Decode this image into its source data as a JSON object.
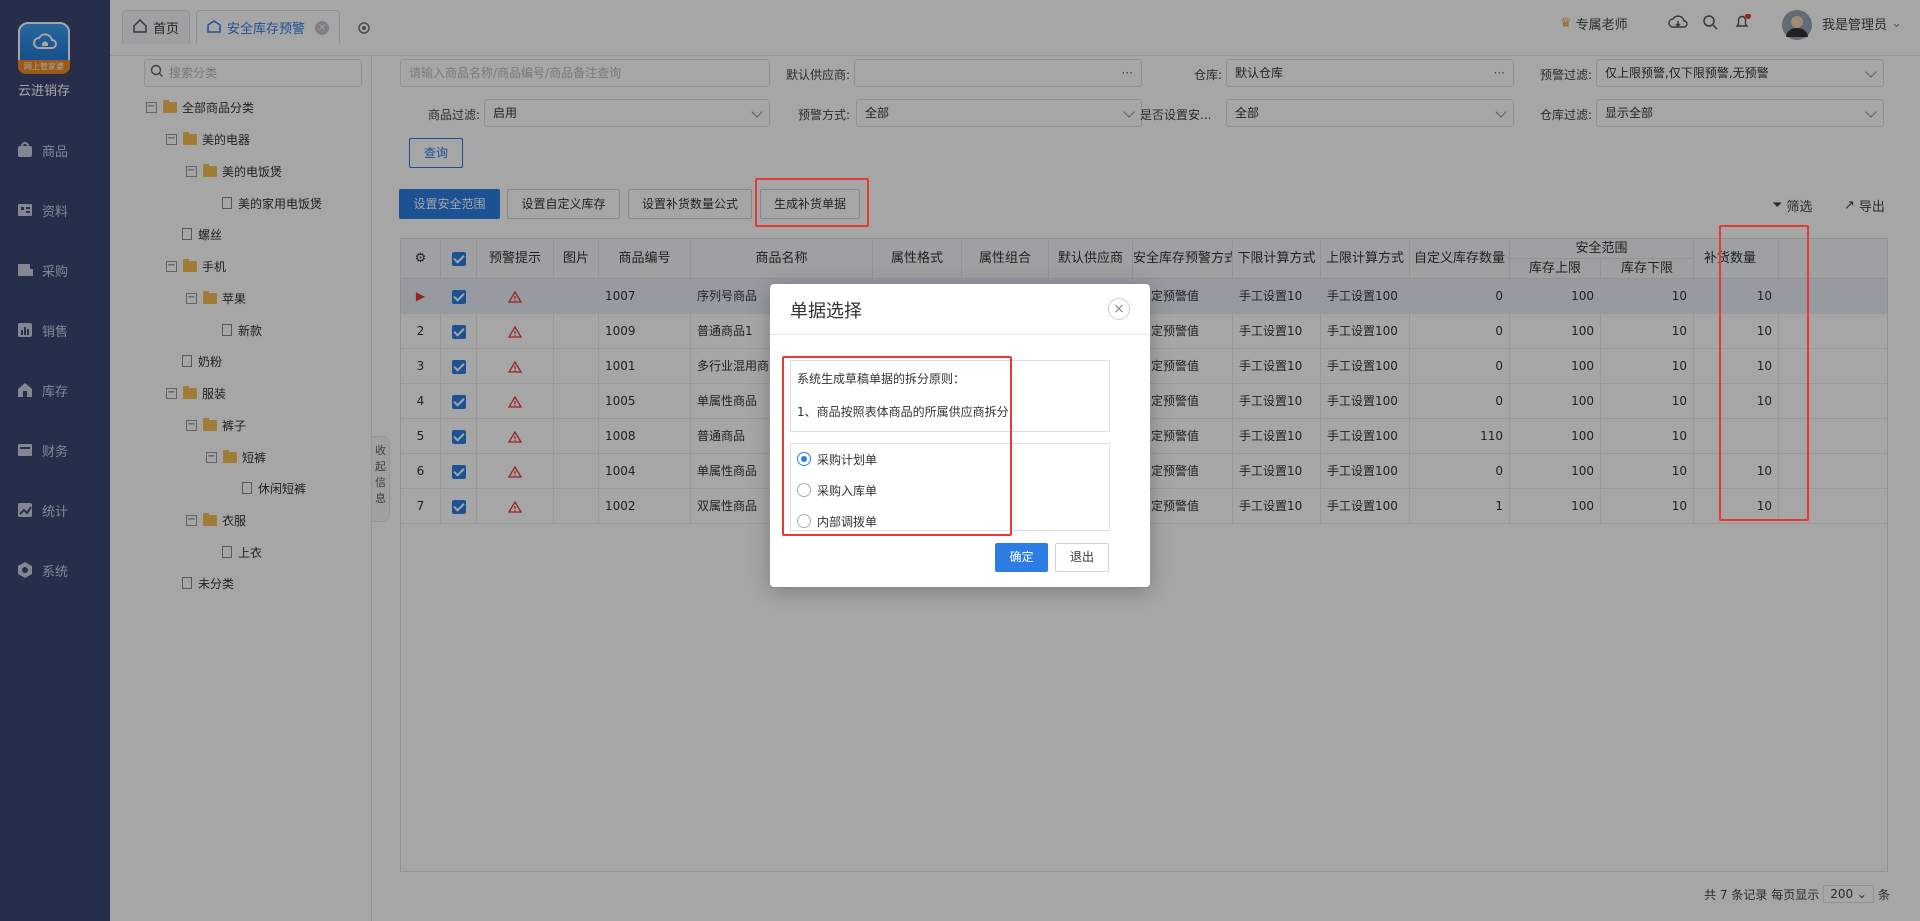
{
  "sidebar": {
    "brand": "云进销存",
    "logo_badge": "网上管家婆",
    "items": [
      {
        "label": "商品",
        "icon": "bag-icon"
      },
      {
        "label": "资料",
        "icon": "data-icon"
      },
      {
        "label": "采购",
        "icon": "purchase-icon"
      },
      {
        "label": "销售",
        "icon": "sales-icon"
      },
      {
        "label": "库存",
        "icon": "stock-icon"
      },
      {
        "label": "财务",
        "icon": "finance-icon"
      },
      {
        "label": "统计",
        "icon": "chart-icon"
      },
      {
        "label": "系统",
        "icon": "gear-icon"
      }
    ]
  },
  "tabs": {
    "home": "首页",
    "active": "安全库存预警"
  },
  "topbar": {
    "teacher": "专属老师",
    "user": "我是管理员"
  },
  "tree": {
    "search_placeholder": "搜索分类",
    "nodes": [
      "全部商品分类",
      "美的电器",
      "美的电饭煲",
      "美的家用电饭煲",
      "螺丝",
      "手机",
      "苹果",
      "新款",
      "奶粉",
      "服装",
      "裤子",
      "短裤",
      "休闲短裤",
      "衣服",
      "上衣",
      "未分类"
    ],
    "collapse_label": "收起信息"
  },
  "filters": {
    "search_placeholder": "请输入商品名称/商品编号/商品备注查询",
    "supplier_label": "默认供应商:",
    "warehouse_label": "仓库:",
    "warehouse_value": "默认仓库",
    "warn_filter_label": "预警过滤:",
    "warn_filter_value": "仅上限预警,仅下限预警,无预警",
    "product_filter_label": "商品过滤:",
    "product_filter_value": "启用",
    "warn_mode_label": "预警方式:",
    "warn_mode_value": "全部",
    "safe_set_label": "是否设置安...",
    "safe_set_value": "全部",
    "wh_filter_label": "仓库过滤:",
    "wh_filter_value": "显示全部",
    "query": "查询"
  },
  "toolbar": {
    "set_range": "设置安全范围",
    "set_custom": "设置自定义库存",
    "set_formula": "设置补货数量公式",
    "generate": "生成补货单据",
    "filter": "筛选",
    "export": "导出"
  },
  "table": {
    "headers": [
      "预警提示",
      "图片",
      "商品编号",
      "商品名称",
      "属性格式",
      "属性组合",
      "默认供应商",
      "安全库存预警方式",
      "下限计算方式",
      "上限计算方式",
      "自定义库存数量",
      "安全范围",
      "库存上限",
      "库存下限",
      "补货数量"
    ],
    "rows": [
      {
        "no": "1",
        "code": "1007",
        "name": "序列号商品",
        "mode": "固定预警值",
        "low": "手工设置10",
        "high": "手工设置100",
        "custom": "0",
        "upper": "100",
        "lower": "10",
        "qty": "10"
      },
      {
        "no": "2",
        "code": "1009",
        "name": "普通商品1",
        "mode": "固定预警值",
        "low": "手工设置10",
        "high": "手工设置100",
        "custom": "0",
        "upper": "100",
        "lower": "10",
        "qty": "10"
      },
      {
        "no": "3",
        "code": "1001",
        "name": "多行业混用商品",
        "mode": "固定预警值",
        "low": "手工设置10",
        "high": "手工设置100",
        "custom": "0",
        "upper": "100",
        "lower": "10",
        "qty": "10"
      },
      {
        "no": "4",
        "code": "1005",
        "name": "单属性商品",
        "mode": "固定预警值",
        "low": "手工设置10",
        "high": "手工设置100",
        "custom": "0",
        "upper": "100",
        "lower": "10",
        "qty": "10"
      },
      {
        "no": "5",
        "code": "1008",
        "name": "普通商品",
        "mode": "固定预警值",
        "low": "手工设置10",
        "high": "手工设置100",
        "custom": "110",
        "upper": "100",
        "lower": "10",
        "qty": ""
      },
      {
        "no": "6",
        "code": "1004",
        "name": "单属性商品",
        "mode": "固定预警值",
        "low": "手工设置10",
        "high": "手工设置100",
        "custom": "0",
        "upper": "100",
        "lower": "10",
        "qty": "10"
      },
      {
        "no": "7",
        "code": "1002",
        "name": "双属性商品",
        "mode": "固定预警值",
        "low": "手工设置10",
        "high": "手工设置100",
        "custom": "1",
        "upper": "100",
        "lower": "10",
        "qty": "10"
      }
    ]
  },
  "footer": {
    "total": "共 7 条记录  每页显示",
    "page_size": "200",
    "unit": "条"
  },
  "modal": {
    "title": "单据选择",
    "rule_title": "系统生成草稿单据的拆分原则：",
    "rule_1": "1、商品按照表体商品的所属供应商拆分",
    "options": [
      "采购计划单",
      "采购入库单",
      "内部调拨单"
    ],
    "ok": "确定",
    "cancel": "退出"
  },
  "colors": {
    "sidebar": "#3b4876",
    "accent": "#2b7de3",
    "highlight": "#e53935"
  }
}
